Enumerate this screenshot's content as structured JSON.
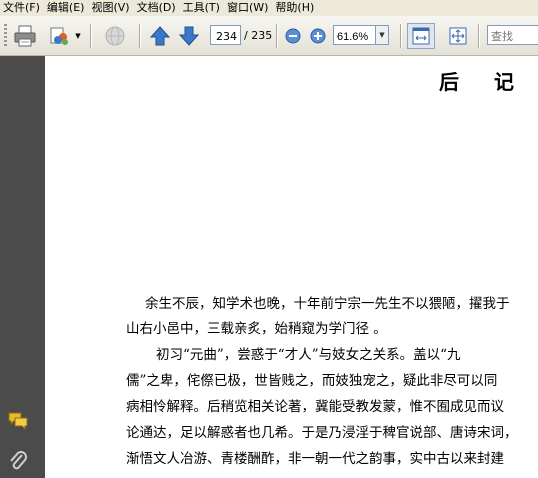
{
  "menu": [
    "文件(F)",
    "编辑(E)",
    "视图(V)",
    "文档(D)",
    "工具(T)",
    "窗口(W)",
    "帮助(H)"
  ],
  "toolbar": {
    "current_page": "234",
    "total_pages": "/ 235",
    "zoom": "61.6%",
    "search_placeholder": "查找"
  },
  "document": {
    "heading_left": "后",
    "heading_right": "记",
    "lines": [
      "余生不辰，知学术也晚，十年前宁宗一先生不以猥陋，擢我于",
      "山右小邑中，三载亲炙，始稍窥为学门径 。",
      "初习“元曲”，尝惑于“才人”与妓女之关系。盖以“九",
      "儒”之卑，侘傺已极，世皆贱之，而妓独宠之，疑此非尽可以同",
      "病相怜解释。后稍览相关论著，冀能受教发蒙，惟不囿成见而议",
      "论通达，足以解惑者也几希。于是乃浸淫于稗官说部、唐诗宋词，",
      "渐悟文人冶游、青楼酬酢，非一朝一代之韵事，实中古以来封建"
    ]
  },
  "colors": {
    "menubar_bg": "#ece9d8",
    "toolbar_bg": "#e8e6dc",
    "leftnav_bg": "#4b4b4b",
    "accent_blue": "#3a78c8"
  }
}
